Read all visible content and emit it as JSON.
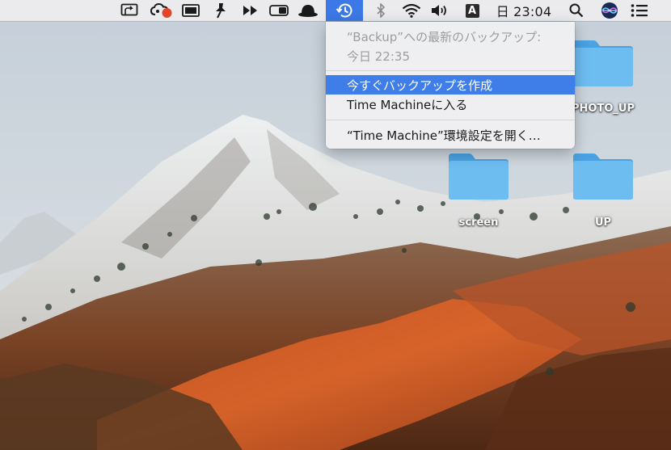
{
  "menubar": {
    "input_source_letter": "A",
    "clock": "日 23:04"
  },
  "time_machine_menu": {
    "last_backup_line1": "“Backup”への最新のバックアップ:",
    "last_backup_line2": "今日 22:35",
    "items": [
      {
        "label": "今すぐバックアップを作成",
        "highlighted": true
      },
      {
        "label": "Time Machineに入る",
        "highlighted": false
      },
      {
        "label": "“Time Machine”環境設定を開く…",
        "highlighted": false
      }
    ]
  },
  "desktop": {
    "folders": [
      {
        "label": "PHOTO_UP"
      },
      {
        "label": "screen"
      },
      {
        "label": "UP"
      }
    ]
  },
  "colors": {
    "menu_highlight": "#3f7ee8",
    "menubar_active": "#3c79e6",
    "folder_blue": "#5fb3ee",
    "record_dot": "#e2452a"
  }
}
